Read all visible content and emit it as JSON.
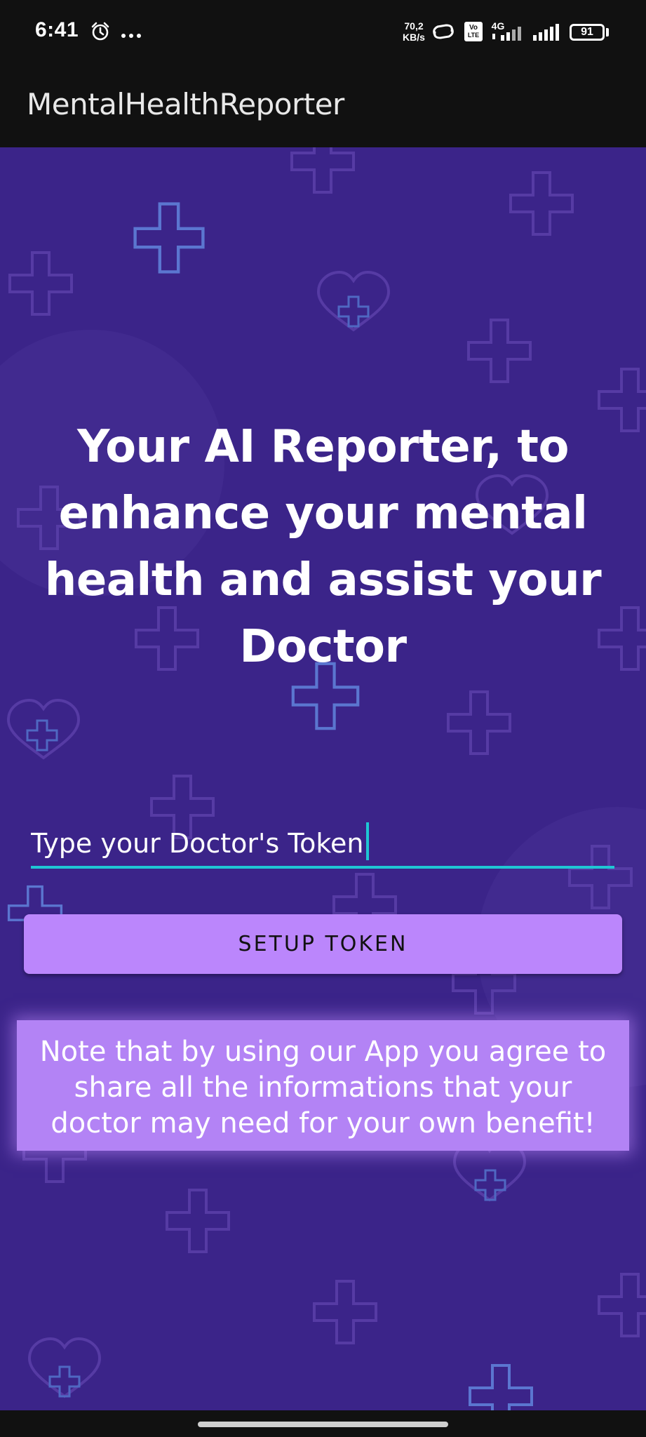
{
  "status_bar": {
    "time": "6:41",
    "network_speed_value": "70,2",
    "network_speed_unit": "KB/s",
    "volte_top": "Vo",
    "volte_bottom": "LTE",
    "network_type": "4G",
    "battery_level": "91",
    "icons": [
      "alarm-icon",
      "more-icon",
      "hotspot-link-icon",
      "signal-icon",
      "signal-icon",
      "battery-icon"
    ]
  },
  "app_bar": {
    "title": "MentalHealthReporter"
  },
  "main": {
    "headline": "Your AI Reporter, to enhance your mental health and assist your Doctor",
    "token_input": {
      "placeholder": "Type your Doctor's Token",
      "value": ""
    },
    "setup_button_label": "SETUP TOKEN",
    "note": "Note that by using our App you agree to share all the informations that your doctor may need for your own benefit!"
  },
  "colors": {
    "background": "#3b2489",
    "accent": "#1fc6d4",
    "button": "#bb86fc",
    "note_box": "#b383f5",
    "pattern": "#5b76d0"
  }
}
